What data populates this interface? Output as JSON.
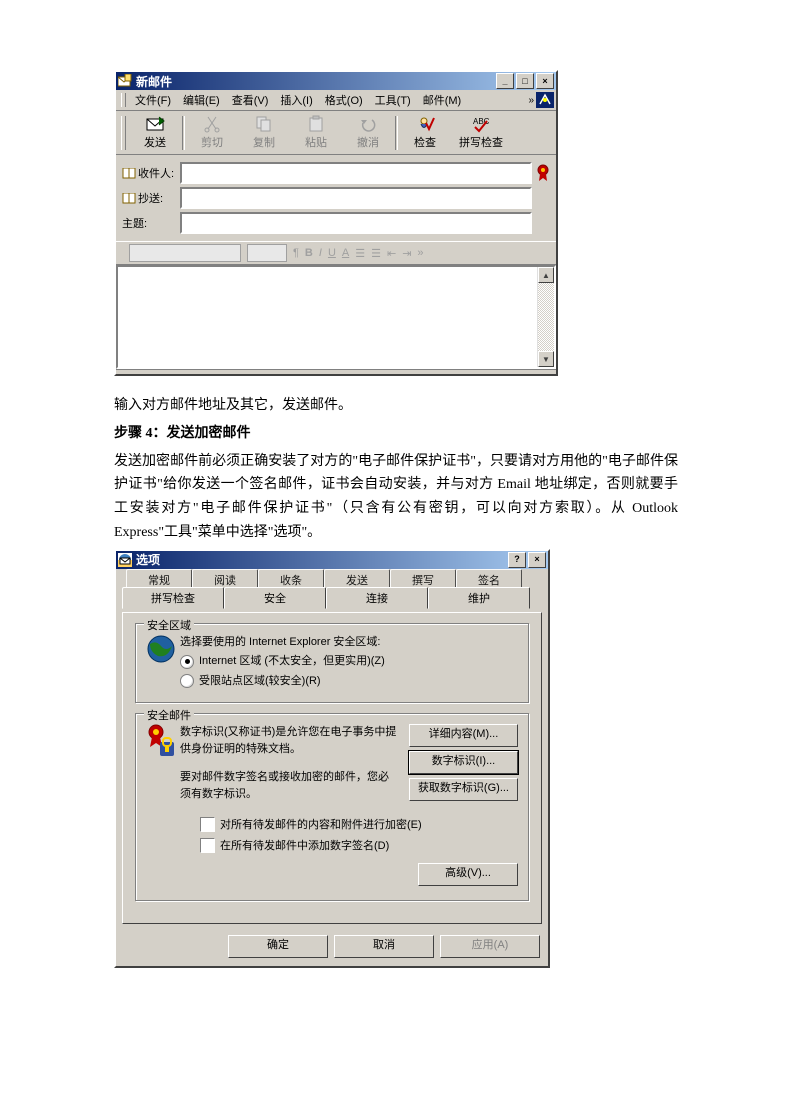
{
  "win1": {
    "title": "新邮件",
    "menus": [
      "文件(F)",
      "编辑(E)",
      "查看(V)",
      "插入(I)",
      "格式(O)",
      "工具(T)",
      "邮件(M)"
    ],
    "toolbar": {
      "send": "发送",
      "cut": "剪切",
      "copy": "复制",
      "paste": "粘贴",
      "undo": "撤消",
      "check": "检查",
      "spell": "拼写检查"
    },
    "fields": {
      "to": "收件人:",
      "cc": "抄送:",
      "subject": "主题:"
    }
  },
  "prose": {
    "p1": "输入对方邮件地址及其它，发送邮件。",
    "step": "步骤 4：发送加密邮件",
    "p2": "发送加密邮件前必须正确安装了对方的\"电子邮件保护证书\"，只要请对方用他的\"电子邮件保护证书\"给你发送一个签名邮件，证书会自动安装，并与对方 Email 地址绑定，否则就要手工安装对方\"电子邮件保护证书\"（只含有公有密钥，可以向对方索取）。从 Outlook Express\"工具\"菜单中选择\"选项\"。"
  },
  "win2": {
    "title": "选项",
    "tabs_back": [
      "常规",
      "阅读",
      "收条",
      "发送",
      "撰写",
      "签名"
    ],
    "tabs_front": [
      "拼写检查",
      "安全",
      "连接",
      "维护"
    ],
    "group_zone": {
      "legend": "安全区域",
      "prompt": "选择要使用的 Internet Explorer 安全区域:",
      "opt1": "Internet 区域 (不太安全，但更实用)(Z)",
      "opt2": "受限站点区域(较安全)(R)"
    },
    "group_mail": {
      "legend": "安全邮件",
      "desc1": "数字标识(又称证书)是允许您在电子事务中提供身份证明的特殊文档。",
      "desc2": "要对邮件数字签名或接收加密的邮件，您必须有数字标识。",
      "btn_more": "详细内容(M)...",
      "btn_id": "数字标识(I)...",
      "btn_get": "获取数字标识(G)...",
      "chk1": "对所有待发邮件的内容和附件进行加密(E)",
      "chk2": "在所有待发邮件中添加数字签名(D)",
      "btn_adv": "高级(V)..."
    },
    "buttons": {
      "ok": "确定",
      "cancel": "取消",
      "apply": "应用(A)"
    }
  }
}
